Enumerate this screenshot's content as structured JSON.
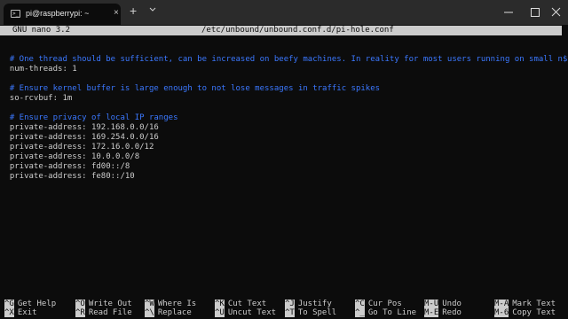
{
  "window": {
    "tab_title": "pi@raspberrypi: ~",
    "tab_close": "×",
    "new_tab": "+",
    "dropdown": "⌄",
    "minimize": "—",
    "maximize": "☐",
    "close": "✕"
  },
  "nano": {
    "version": "GNU nano 3.2",
    "filename": "/etc/unbound/unbound.conf.d/pi-hole.conf"
  },
  "file_lines": [
    {
      "text": "  # One thread should be sufficient, can be increased on beefy machines. In reality for most users running on small n$",
      "type": "comment"
    },
    {
      "text": "  num-threads: 1",
      "type": "code"
    },
    {
      "text": "",
      "type": "code"
    },
    {
      "text": "  # Ensure kernel buffer is large enough to not lose messages in traffic spikes",
      "type": "comment"
    },
    {
      "text": "  so-rcvbuf: 1m",
      "type": "code"
    },
    {
      "text": "",
      "type": "code"
    },
    {
      "text": "  # Ensure privacy of local IP ranges",
      "type": "comment"
    },
    {
      "text": "  private-address: 192.168.0.0/16",
      "type": "code"
    },
    {
      "text": "  private-address: 169.254.0.0/16",
      "type": "code"
    },
    {
      "text": "  private-address: 172.16.0.0/12",
      "type": "code"
    },
    {
      "text": "  private-address: 10.0.0.0/8",
      "type": "code"
    },
    {
      "text": "  private-address: fd00::/8",
      "type": "code"
    },
    {
      "text": "  private-address: fe80::/10",
      "type": "code"
    }
  ],
  "shortcuts_row1": [
    {
      "key": "^G",
      "label": "Get Help"
    },
    {
      "key": "^O",
      "label": "Write Out"
    },
    {
      "key": "^W",
      "label": "Where Is"
    },
    {
      "key": "^K",
      "label": "Cut Text"
    },
    {
      "key": "^J",
      "label": "Justify"
    },
    {
      "key": "^C",
      "label": "Cur Pos"
    },
    {
      "key": "M-U",
      "label": "Undo"
    },
    {
      "key": "M-A",
      "label": "Mark Text"
    }
  ],
  "shortcuts_row2": [
    {
      "key": "^X",
      "label": "Exit"
    },
    {
      "key": "^R",
      "label": "Read File"
    },
    {
      "key": "^\\",
      "label": "Replace"
    },
    {
      "key": "^U",
      "label": "Uncut Text"
    },
    {
      "key": "^T",
      "label": "To Spell"
    },
    {
      "key": "^_",
      "label": "Go To Line"
    },
    {
      "key": "M-E",
      "label": "Redo"
    },
    {
      "key": "M-6",
      "label": "Copy Text"
    }
  ]
}
